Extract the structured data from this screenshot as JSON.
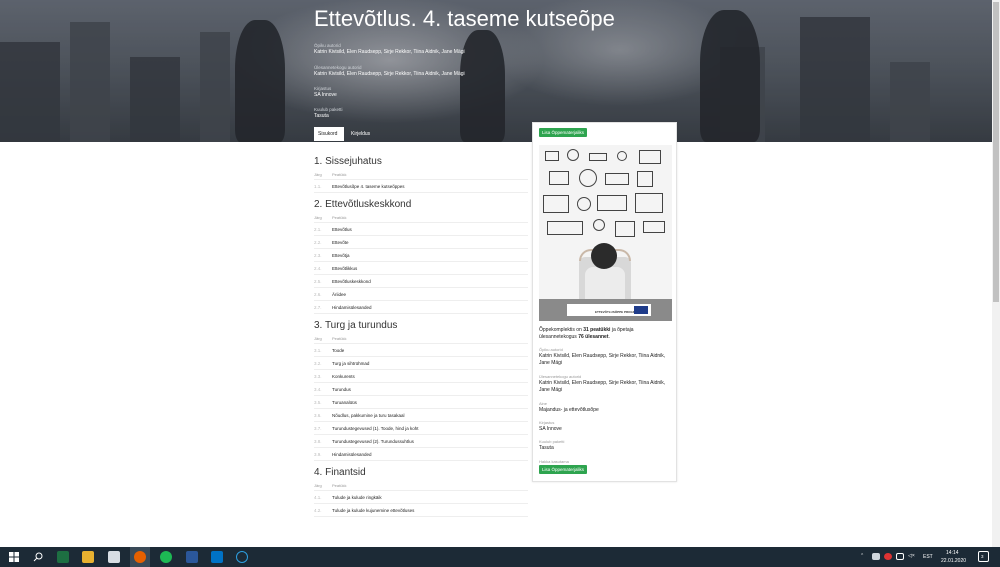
{
  "hero": {
    "title": "Ettevõtlus. 4. taseme kutseõpe",
    "authors_label": "Õpiku autorid",
    "authors": "Katrin Kivisild, Elen Raudsepp, Sirje Rekkor, Tiina Aidnik, Jane Mägi",
    "task_authors_label": "Ülesannetekogu autorid",
    "task_authors": "Katrin Kivisild, Elen Raudsepp, Sirje Rekkor, Tiina Aidnik, Jane Mägi",
    "publisher_label": "Kirjastus",
    "publisher": "SA Innove",
    "package_label": "Kuulub paketti",
    "package": "Tasuta"
  },
  "tabs": [
    {
      "label": "Sisukord",
      "active": true
    },
    {
      "label": "Kirjeldus",
      "active": false
    }
  ],
  "toc": {
    "col_order": "Järg",
    "col_chapter": "Peatükk",
    "sections": [
      {
        "title": "1. Sissejuhatus",
        "items": [
          {
            "num": "1.1.",
            "name": "Ettevõtlusõpe 4. taseme kutseõppes"
          }
        ]
      },
      {
        "title": "2. Ettevõtluskeskkond",
        "items": [
          {
            "num": "2.1.",
            "name": "Ettevõtlus"
          },
          {
            "num": "2.2.",
            "name": "Ettevõte"
          },
          {
            "num": "2.3.",
            "name": "Ettevõtja"
          },
          {
            "num": "2.4.",
            "name": "Ettevõtlikkus"
          },
          {
            "num": "2.5.",
            "name": "Ettevõtluskeskkond"
          },
          {
            "num": "2.6.",
            "name": "Äriidee"
          },
          {
            "num": "2.7.",
            "name": "Hindamisülesanded"
          }
        ]
      },
      {
        "title": "3. Turg ja turundus",
        "items": [
          {
            "num": "3.1.",
            "name": "Toode"
          },
          {
            "num": "3.2.",
            "name": "Turg ja sihtrühmad"
          },
          {
            "num": "3.3.",
            "name": "Konkurents"
          },
          {
            "num": "3.4.",
            "name": "Turundus"
          },
          {
            "num": "3.5.",
            "name": "Turuanalüüs"
          },
          {
            "num": "3.6.",
            "name": "Nõudlus, pakkumine ja turu tasakaal"
          },
          {
            "num": "3.7.",
            "name": "Turundustegevused (1). Toode, hind ja koht"
          },
          {
            "num": "3.8.",
            "name": "Turundustegevused (2). Turundussuhtlus"
          },
          {
            "num": "3.9.",
            "name": "Hindamisülesanded"
          }
        ]
      },
      {
        "title": "4. Finantsid",
        "items": [
          {
            "num": "4.1.",
            "name": "Tulude ja kulude ringkäik"
          },
          {
            "num": "4.2.",
            "name": "Tulude ja kulude kujunemine ettevõtluses"
          }
        ]
      }
    ]
  },
  "card": {
    "add_button": "Lisa Õppematerjaliks",
    "cover_logo_text": "ETTEVÕTLUSÕPPE PROGRAMM",
    "summary_pre": "Õppekomplektis on ",
    "summary_chapters": "31 peatükki",
    "summary_mid": " ja õpetaja ülesannetekogus ",
    "summary_tasks": "76 ülesannet",
    "summary_end": ".",
    "authors_label": "Õpiku autorid",
    "authors": "Katrin Kivisild, Elen Raudsepp, Sirje Rekkor, Tiina Aidnik, Jane Mägi",
    "task_authors_label": "Ülesannetekogu autorid",
    "task_authors": "Katrin Kivisild, Elen Raudsepp, Sirje Rekkor, Tiina Aidnik, Jane Mägi",
    "subject_label": "Aine",
    "subject": "Majandus- ja ettevõtlusõpe",
    "publisher_label": "Kirjastus",
    "publisher": "SA Innove",
    "package_label": "Kuulub paketti",
    "package": "Tasuta",
    "start_label": "Hakka kasutama",
    "start_button": "Lisa Õppematerjaliks"
  },
  "taskbar": {
    "language": "EST",
    "time": "14:14",
    "date": "22.01.2020",
    "notifications": "3"
  }
}
